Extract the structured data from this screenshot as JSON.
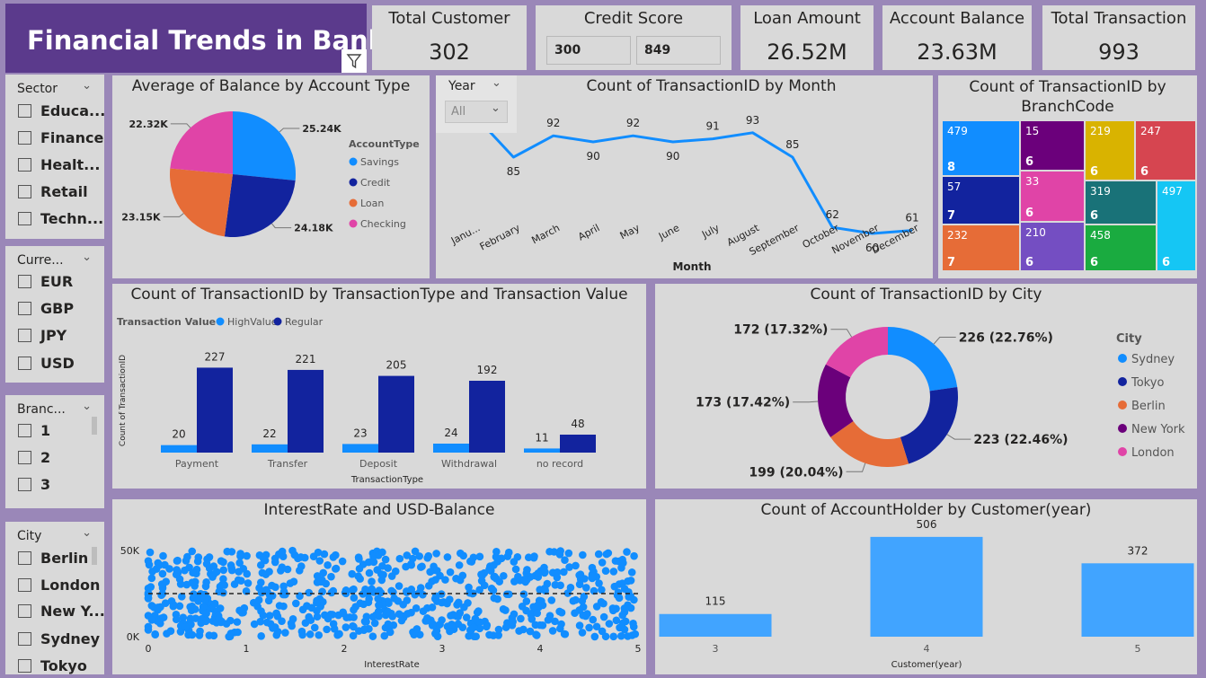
{
  "dashboard": {
    "title": "Financial Trends in Bank"
  },
  "kpis": {
    "total_customer": {
      "label": "Total Customer",
      "value": "302"
    },
    "credit_score": {
      "label": "Credit Score",
      "min": "300",
      "max": "849"
    },
    "loan_amount": {
      "label": "Loan Amount",
      "value": "26.52M"
    },
    "account_balance": {
      "label": "Account Balance",
      "value": "23.63M"
    },
    "total_transaction": {
      "label": "Total Transaction",
      "value": "993"
    }
  },
  "slicers": {
    "sector": {
      "header": "Sector",
      "items": [
        "Educa...",
        "Finance",
        "Healt...",
        "Retail",
        "Techn..."
      ]
    },
    "currency": {
      "header": "Curre...",
      "items": [
        "EUR",
        "GBP",
        "JPY",
        "USD"
      ]
    },
    "branch": {
      "header": "Branc...",
      "items": [
        "1",
        "2",
        "3"
      ]
    },
    "city": {
      "header": "City",
      "items": [
        "Berlin",
        "London",
        "New Y...",
        "Sydney",
        "Tokyo"
      ]
    },
    "year": {
      "header": "Year",
      "value": "All"
    }
  },
  "colors": {
    "banner": "#5b3a8c",
    "background": "#9a87b8",
    "card": "#d9d9d9",
    "light_blue": "#118dff",
    "dark_blue": "#12239e",
    "orange": "#e66c37",
    "purple": "#6b007b",
    "pink": "#e044a7",
    "bar_light": "#41a4ff"
  },
  "chart_data": [
    {
      "id": "pie",
      "type": "pie",
      "title": "Average of Balance by Account Type",
      "legend_title": "AccountType",
      "legend_position": "right",
      "slices": [
        {
          "name": "Savings",
          "value": 25.24,
          "label": "25.24K",
          "color": "#118dff"
        },
        {
          "name": "Credit",
          "value": 24.18,
          "label": "24.18K",
          "color": "#12239e"
        },
        {
          "name": "Loan",
          "value": 23.15,
          "label": "23.15K",
          "color": "#e66c37"
        },
        {
          "name": "Checking",
          "value": 22.32,
          "label": "22.32K",
          "color": "#e044a7"
        }
      ]
    },
    {
      "id": "line",
      "type": "line",
      "title": "Count of TransactionID by Month",
      "xlabel": "Month",
      "categories": [
        "Janu...",
        "February",
        "March",
        "April",
        "May",
        "June",
        "July",
        "August",
        "September",
        "October",
        "November",
        "December"
      ],
      "values": [
        99,
        85,
        92,
        90,
        92,
        90,
        91,
        93,
        85,
        62,
        60,
        61
      ],
      "labels": [
        "",
        "85",
        "92",
        "90",
        "92",
        "90",
        "91",
        "93",
        "85",
        "62",
        "60",
        "61"
      ],
      "ylim": [
        50,
        100
      ],
      "color": "#118dff"
    },
    {
      "id": "treemap",
      "type": "treemap",
      "title": "Count of TransactionID by BranchCode",
      "cells": [
        {
          "value": 479,
          "label": "8",
          "color": "#118dff"
        },
        {
          "value": 57,
          "label": "7",
          "color": "#12239e"
        },
        {
          "value": 232,
          "label": "7",
          "color": "#e66c37"
        },
        {
          "value": 15,
          "label": "6",
          "color": "#6b007b"
        },
        {
          "value": 33,
          "label": "6",
          "color": "#e044a7"
        },
        {
          "value": 210,
          "label": "6",
          "color": "#744ec2"
        },
        {
          "value": 219,
          "label": "6",
          "color": "#d9b300"
        },
        {
          "value": 247,
          "label": "6",
          "color": "#d64550"
        },
        {
          "value": 319,
          "label": "6",
          "color": "#197278"
        },
        {
          "value": 458,
          "label": "6",
          "color": "#1aab40"
        },
        {
          "value": 497,
          "label": "6",
          "color": "#15c6f4"
        }
      ]
    },
    {
      "id": "clustered",
      "type": "bar",
      "title": "Count of TransactionID by TransactionType and Transaction Value",
      "legend_title": "Transaction Value",
      "legend_position": "top-left",
      "xlabel": "TransactionType",
      "ylabel": "Count of TransactionID",
      "categories": [
        "Payment",
        "Transfer",
        "Deposit",
        "Withdrawal",
        "no record"
      ],
      "series": [
        {
          "name": "HighValue",
          "values": [
            20,
            22,
            23,
            24,
            11
          ],
          "color": "#118dff"
        },
        {
          "name": "Regular",
          "values": [
            227,
            221,
            205,
            192,
            48
          ],
          "color": "#12239e"
        }
      ],
      "ylim": [
        0,
        240
      ]
    },
    {
      "id": "donut",
      "type": "pie",
      "title": "Count of TransactionID by City",
      "legend_title": "City",
      "legend_position": "right",
      "slices": [
        {
          "name": "Sydney",
          "value": 226,
          "label": "226 (22.76%)",
          "color": "#118dff"
        },
        {
          "name": "Tokyo",
          "value": 223,
          "label": "223 (22.46%)",
          "color": "#12239e"
        },
        {
          "name": "Berlin",
          "value": 199,
          "label": "199 (20.04%)",
          "color": "#e66c37"
        },
        {
          "name": "New York",
          "value": 173,
          "label": "173 (17.42%)",
          "color": "#6b007b"
        },
        {
          "name": "London",
          "value": 172,
          "label": "172 (17.32%)",
          "color": "#e044a7"
        }
      ]
    },
    {
      "id": "scatter",
      "type": "scatter",
      "title": "InterestRate and USD-Balance",
      "xlabel": "InterestRate",
      "x_ticks": [
        "0",
        "1",
        "2",
        "3",
        "4",
        "5"
      ],
      "y_ticks": [
        "0K",
        "50K"
      ],
      "xlim": [
        0,
        5
      ],
      "ylim": [
        0,
        50000
      ],
      "point_count": 700,
      "trend_value": 25000,
      "color": "#118dff"
    },
    {
      "id": "column",
      "type": "bar",
      "title": "Count of AccountHolder by Customer(year)",
      "xlabel": "Customer(year)",
      "categories": [
        "3",
        "4",
        "5"
      ],
      "values": [
        115,
        506,
        372
      ],
      "ylim": [
        0,
        560
      ],
      "color": "#41a4ff"
    }
  ]
}
